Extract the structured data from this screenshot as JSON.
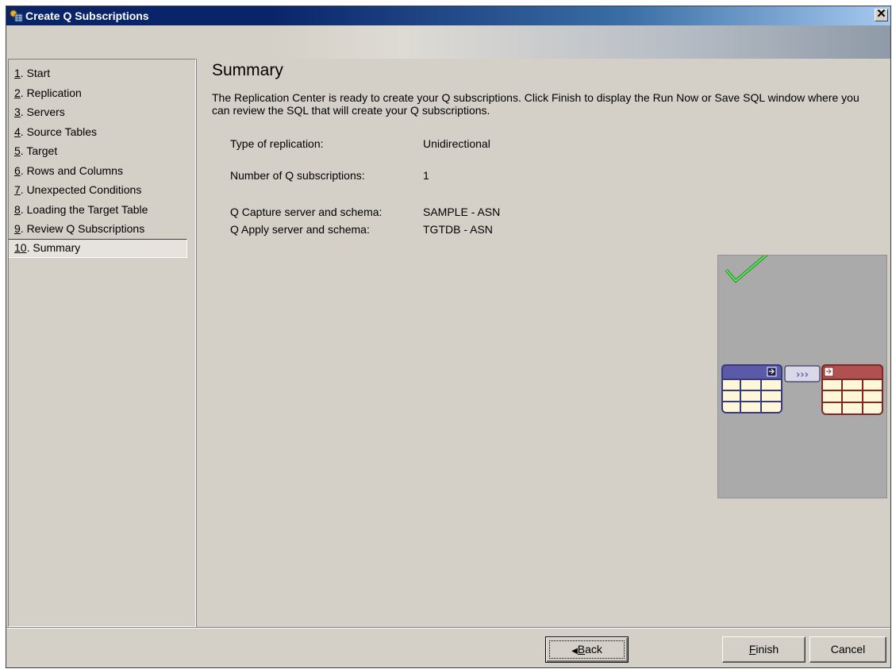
{
  "window": {
    "title": "Create Q Subscriptions",
    "close_glyph": "✕"
  },
  "nav": {
    "items": [
      {
        "num": "1",
        "label": ". Start"
      },
      {
        "num": "2",
        "label": ". Replication"
      },
      {
        "num": "3",
        "label": ". Servers"
      },
      {
        "num": "4",
        "label": ". Source Tables"
      },
      {
        "num": "5",
        "label": ". Target"
      },
      {
        "num": "6",
        "label": ". Rows and Columns"
      },
      {
        "num": "7",
        "label": ". Unexpected Conditions"
      },
      {
        "num": "8",
        "label": ". Loading the Target Table"
      },
      {
        "num": "9",
        "label": ". Review Q Subscriptions"
      },
      {
        "num": "10",
        "label": ". Summary"
      }
    ],
    "selected_index": 9
  },
  "summary": {
    "title": "Summary",
    "intro": "The Replication Center is ready to create your Q subscriptions.  Click Finish to display the Run Now or Save SQL window where you can review the SQL that will create your Q subscriptions.",
    "type_label": "Type of replication:",
    "type_value": "Unidirectional",
    "count_label": "Number of Q subscriptions:",
    "count_value": "1",
    "capture_label": "Q Capture server and schema:",
    "capture_value": "SAMPLE - ASN",
    "apply_label": "Q Apply server and schema:",
    "apply_value": "TGTDB - ASN"
  },
  "graphic": {
    "icons": [
      "checkmark-icon",
      "source-table-icon",
      "replication-arrows-icon",
      "target-table-icon"
    ],
    "colors": {
      "check": "#33cc33",
      "source": "#5a5aa8",
      "target": "#b05050",
      "cell": "#fff8d8"
    }
  },
  "buttons": {
    "back_mnemonic": "B",
    "back_rest": "ack",
    "back_arrow": "◀",
    "finish_mnemonic": "F",
    "finish_rest": "inish",
    "cancel": "Cancel"
  }
}
